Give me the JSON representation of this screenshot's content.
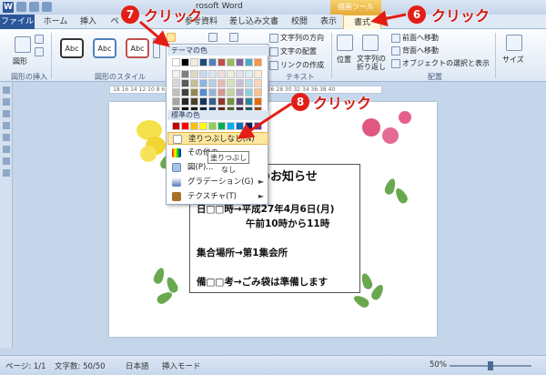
{
  "app": {
    "window_title": "rosoft Word",
    "icon": "word-icon"
  },
  "titlebar": {
    "context_tab": "描画ツール"
  },
  "tabs": [
    "ファイル",
    "ホーム",
    "挿入",
    "ペ",
    "参考資料",
    "差し込み文書",
    "校閲",
    "表示",
    "書式"
  ],
  "ribbon": {
    "insert_shapes": {
      "label": "図形の挿入",
      "shape_btn": "図形"
    },
    "shape_styles": {
      "label": "図形のスタイル",
      "style_boxes": [
        "Abc",
        "Abc",
        "Abc"
      ]
    },
    "text": {
      "label": "テキスト",
      "direction": "文字列の方向",
      "align": "文字の配置",
      "link": "リンクの作成"
    },
    "arrange": {
      "label": "配置",
      "position": "位置",
      "wrap": "文字列の折り返し",
      "bring_forward": "前面へ移動",
      "send_backward": "背面へ移動",
      "selection_pane": "オブジェクトの選択と表示"
    },
    "size": {
      "label": "サイズ"
    }
  },
  "ruler": "18 16 14 12 10 8 6 4 2 2 4 6 8 10 12 14 16 18 20 22 24 26 28 30 32 34 36 38 40",
  "document": {
    "title": "のお知らせ",
    "lines": [
      "日□□時→平成27年4月6日(月)",
      "午前10時から11時",
      "集合場所→第1集会所",
      "備□□考→ごみ袋は準備します"
    ]
  },
  "menu": {
    "theme_colors_header": "テーマの色",
    "standard_colors_header": "標準の色",
    "no_fill": "塗りつぶしなし(N)",
    "other_colors": "その他の",
    "picture": "図(P)...",
    "gradient": "グラデーション(G)",
    "texture": "テクスチャ(T)",
    "theme_colors": [
      [
        "#ffffff",
        "#000000",
        "#eeece1",
        "#1f497d",
        "#4f81bd",
        "#c0504d",
        "#9bbb59",
        "#8064a2",
        "#4bacc6",
        "#f79646"
      ],
      [
        "#f2f2f2",
        "#7f7f7f",
        "#ddd9c3",
        "#c6d9f0",
        "#dbe5f1",
        "#f2dcdb",
        "#ebf1dd",
        "#e5e0ec",
        "#dbeef3",
        "#fdeada"
      ],
      [
        "#d8d8d8",
        "#595959",
        "#c4bd97",
        "#8db3e2",
        "#b8cce4",
        "#e5b9b7",
        "#d7e3bc",
        "#ccc1d9",
        "#b7dde8",
        "#fbd5b5"
      ],
      [
        "#bfbfbf",
        "#3f3f3f",
        "#938953",
        "#548dd4",
        "#95b3d7",
        "#d99694",
        "#c3d69b",
        "#b2a2c7",
        "#92cddc",
        "#fac08f"
      ],
      [
        "#a5a5a5",
        "#262626",
        "#494429",
        "#17365d",
        "#366092",
        "#953734",
        "#76923c",
        "#5f497a",
        "#31859b",
        "#e36c09"
      ],
      [
        "#7f7f7f",
        "#0c0c0c",
        "#1d1b10",
        "#0f243e",
        "#244061",
        "#632423",
        "#4f6128",
        "#3f3151",
        "#205867",
        "#974806"
      ]
    ],
    "standard_colors": [
      "#c00000",
      "#ff0000",
      "#ffc000",
      "#ffff00",
      "#92d050",
      "#00b050",
      "#00b0f0",
      "#0070c0",
      "#002060",
      "#7030a0"
    ]
  },
  "tooltip": "塗りつぶしなし",
  "statusbar": {
    "page": "ページ: 1/1",
    "words": "文字数: 50/50",
    "language": "日本語",
    "mode": "挿入モード",
    "zoom": "50%"
  },
  "annotations": {
    "step6": "6",
    "step7": "7",
    "step8": "8",
    "click_text": "クリック",
    "color": "#e41e16"
  }
}
